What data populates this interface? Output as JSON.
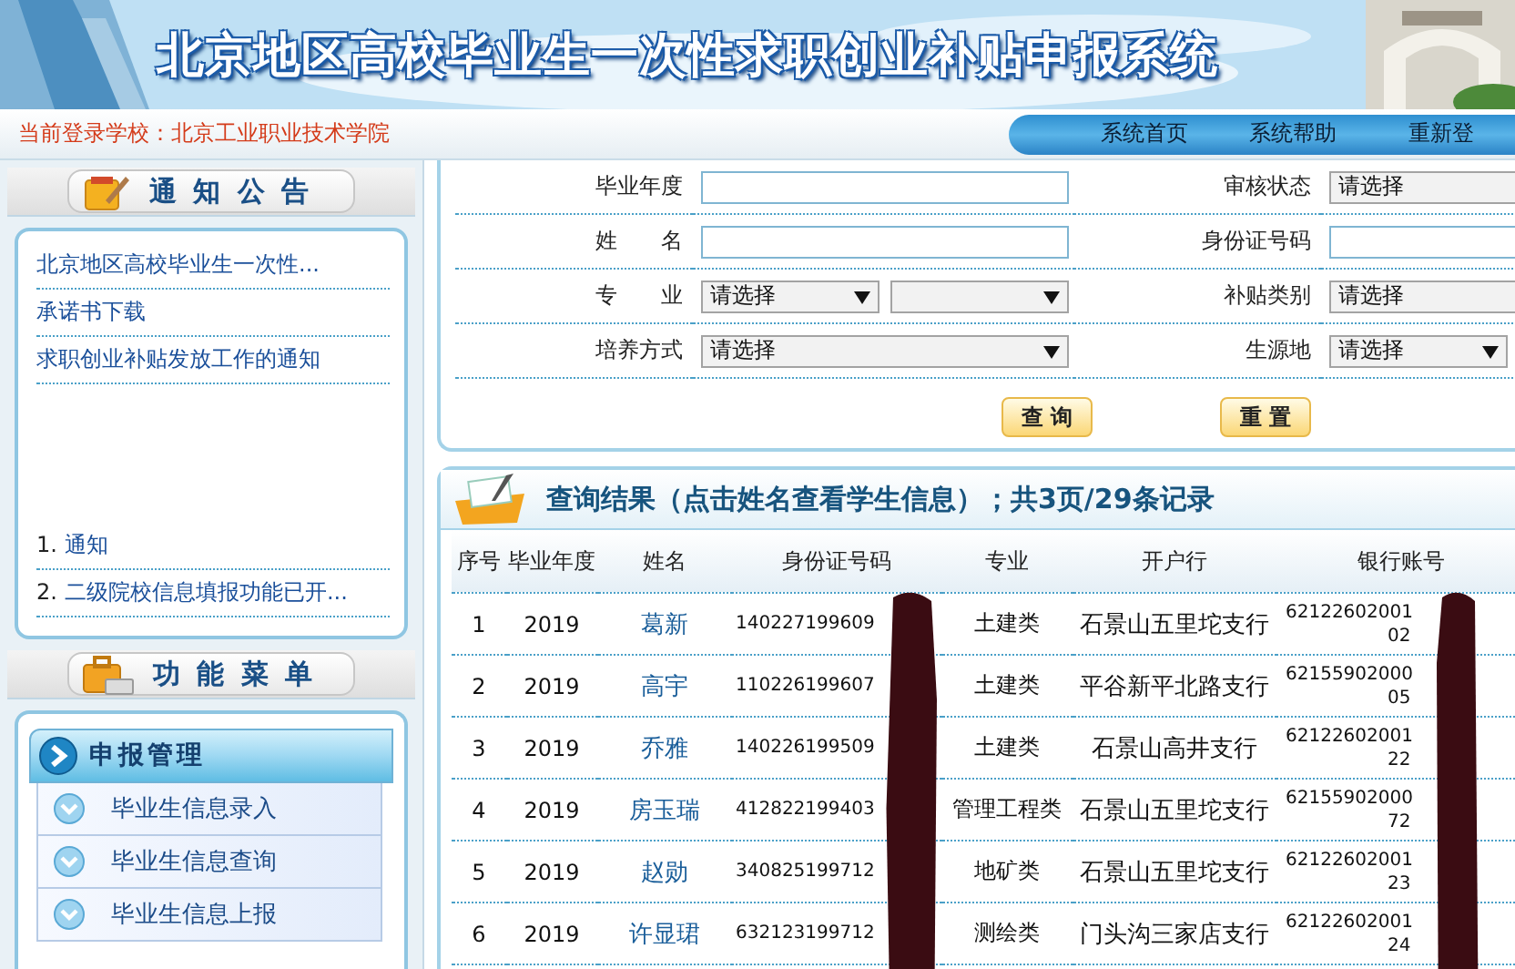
{
  "header": {
    "title": "北京地区高校毕业生一次性求职创业补贴申报系统",
    "login_label": "当前登录学校：北京工业职业技术学院",
    "nav": [
      "系统首页",
      "系统帮助",
      "重新登"
    ]
  },
  "sidebar": {
    "notice_title": "通 知 公 告",
    "notices": [
      "北京地区高校毕业生一次性...",
      "承诺书下载",
      "求职创业补贴发放工作的通知"
    ],
    "numbered_notices": [
      {
        "number": "1.",
        "text": "通知"
      },
      {
        "number": "2.",
        "text": "二级院校信息填报功能已开..."
      }
    ],
    "menu_title": "功 能 菜 单",
    "menu_group": {
      "label": "申报管理",
      "expanded": true,
      "items": [
        "毕业生信息录入",
        "毕业生信息查询",
        "毕业生信息上报"
      ]
    }
  },
  "form": {
    "fields": [
      {
        "label": "毕业年度",
        "kind": "text"
      },
      {
        "label": "审核状态",
        "kind": "clipped_select",
        "value": "请选择"
      },
      {
        "label": "姓　　名",
        "kind": "text"
      },
      {
        "label": "身份证号码",
        "kind": "text"
      },
      {
        "label": "专　　业",
        "kind": "double_select",
        "value": "请选择"
      },
      {
        "label": "补贴类别",
        "kind": "clipped_select",
        "value": "请选择"
      },
      {
        "label": "培养方式",
        "kind": "select",
        "value": "请选择"
      },
      {
        "label": "生源地",
        "kind": "select",
        "value": "请选择"
      }
    ],
    "buttons": [
      "查 询",
      "重 置"
    ]
  },
  "results": {
    "title": "查询结果（点击姓名查看学生信息）；共3页/29条记录",
    "columns": [
      "序号",
      "毕业年度",
      "姓名",
      "身份证号码",
      "专业",
      "开户行",
      "银行账号"
    ],
    "rows": [
      {
        "no": "1",
        "year": "2019",
        "name": "葛新",
        "id": "140227199609",
        "major": "土建类",
        "bank": "石景山五里坨支行",
        "account": [
          "62122602001",
          "02"
        ]
      },
      {
        "no": "2",
        "year": "2019",
        "name": "高宇",
        "id": "110226199607",
        "major": "土建类",
        "bank": "平谷新平北路支行",
        "account": [
          "62155902000",
          "05"
        ]
      },
      {
        "no": "3",
        "year": "2019",
        "name": "乔雅",
        "id": "140226199509",
        "major": "土建类",
        "bank": "石景山高井支行",
        "account": [
          "62122602001",
          "22"
        ]
      },
      {
        "no": "4",
        "year": "2019",
        "name": "房玉瑞",
        "id": "412822199403",
        "major": "管理工程类",
        "bank": "石景山五里坨支行",
        "account": [
          "62155902000",
          "72"
        ]
      },
      {
        "no": "5",
        "year": "2019",
        "name": "赵勋",
        "id": "340825199712",
        "major": "地矿类",
        "bank": "石景山五里坨支行",
        "account": [
          "62122602001",
          "23"
        ]
      },
      {
        "no": "6",
        "year": "2019",
        "name": "许显珺",
        "id": "632123199712",
        "major": "测绘类",
        "bank": "门头沟三家店支行",
        "account": [
          "62122602001",
          "24"
        ]
      }
    ]
  }
}
